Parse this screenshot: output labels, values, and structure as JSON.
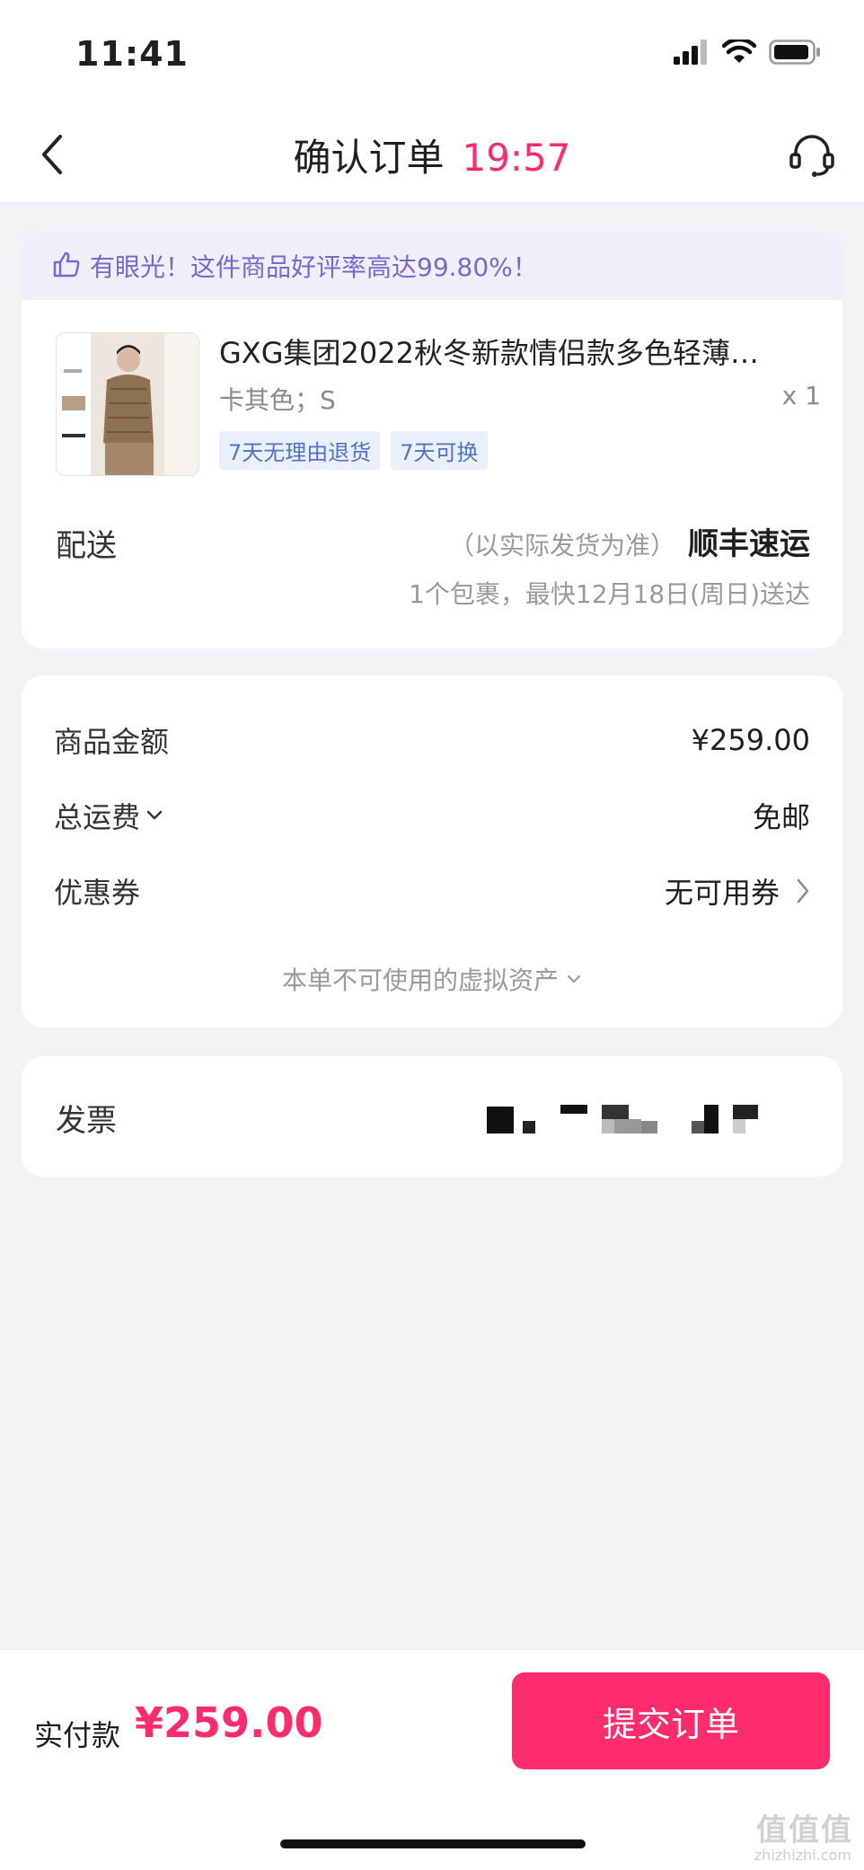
{
  "status_bar": {
    "time": "11:41",
    "icons": [
      "signal-icon",
      "wifi-icon",
      "battery-icon"
    ]
  },
  "nav": {
    "back_icon": "chevron-left-icon",
    "title": "确认订单",
    "countdown": "19:57",
    "service_icon": "headset-icon"
  },
  "product_card": {
    "rating_banner": {
      "icon": "thumbs-up-icon",
      "text": "有眼光！这件商品好评率高达99.80%！"
    },
    "product": {
      "title": "GXG集团2022秋冬新款情侣款多色轻薄…",
      "spec": "卡其色；S",
      "quantity": "x 1",
      "tags": [
        "7天无理由退货",
        "7天可换"
      ]
    },
    "delivery": {
      "label": "配送",
      "note": "（以实际发货为准）",
      "carrier": "顺丰速运",
      "eta": "1个包裹，最快12月18日(周日)送达"
    }
  },
  "price_card": {
    "goods_amount": {
      "label": "商品金额",
      "value": "¥259.00"
    },
    "shipping": {
      "label": "总运费",
      "value": "免邮",
      "icon": "chevron-down-icon"
    },
    "coupon": {
      "label": "优惠券",
      "value": "无可用券",
      "icon": "chevron-right-icon"
    },
    "virtual_assets": "本单不可使用的虚拟资产"
  },
  "invoice": {
    "label": "发票"
  },
  "bottom_bar": {
    "pay_label": "实付款",
    "pay_amount": "¥259.00",
    "submit_label": "提交订单"
  },
  "watermark": {
    "text": "值值值",
    "subtext": "zhizhizhi.com"
  },
  "colors": {
    "accent": "#ff2a6e",
    "submit_button": "#fe2c6c",
    "banner_bg": "#f1eefc",
    "banner_text": "#7968c9",
    "tag_text": "#4e73c4",
    "tag_bg": "#eaf0fb",
    "page_bg": "#f2f3f5"
  }
}
